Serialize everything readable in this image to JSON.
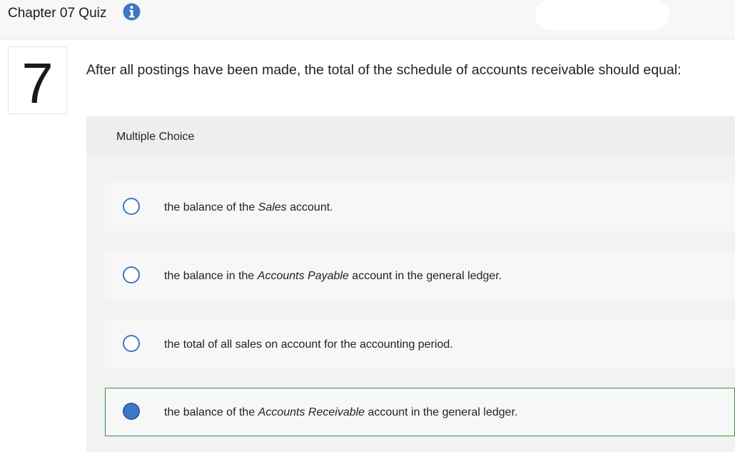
{
  "header": {
    "title": "Chapter 07 Quiz",
    "info_icon": "info-icon"
  },
  "question": {
    "number": "7",
    "text": "After all postings have been made, the total of the schedule of accounts receivable should equal:",
    "type_label": "Multiple Choice"
  },
  "options": [
    {
      "before": "the balance of the ",
      "emphasis": "Sales",
      "after": " account.",
      "selected": false
    },
    {
      "before": "the balance in the ",
      "emphasis": "Accounts Payable",
      "after": " account in the general ledger.",
      "selected": false
    },
    {
      "before": "the total of all sales on account for the accounting period.",
      "emphasis": "",
      "after": "",
      "selected": false
    },
    {
      "before": "the balance of the ",
      "emphasis": "Accounts Receivable",
      "after": " account in the general ledger.",
      "selected": true
    }
  ],
  "colors": {
    "accent_blue": "#3d78c5",
    "selected_border": "#3c8a3c"
  }
}
